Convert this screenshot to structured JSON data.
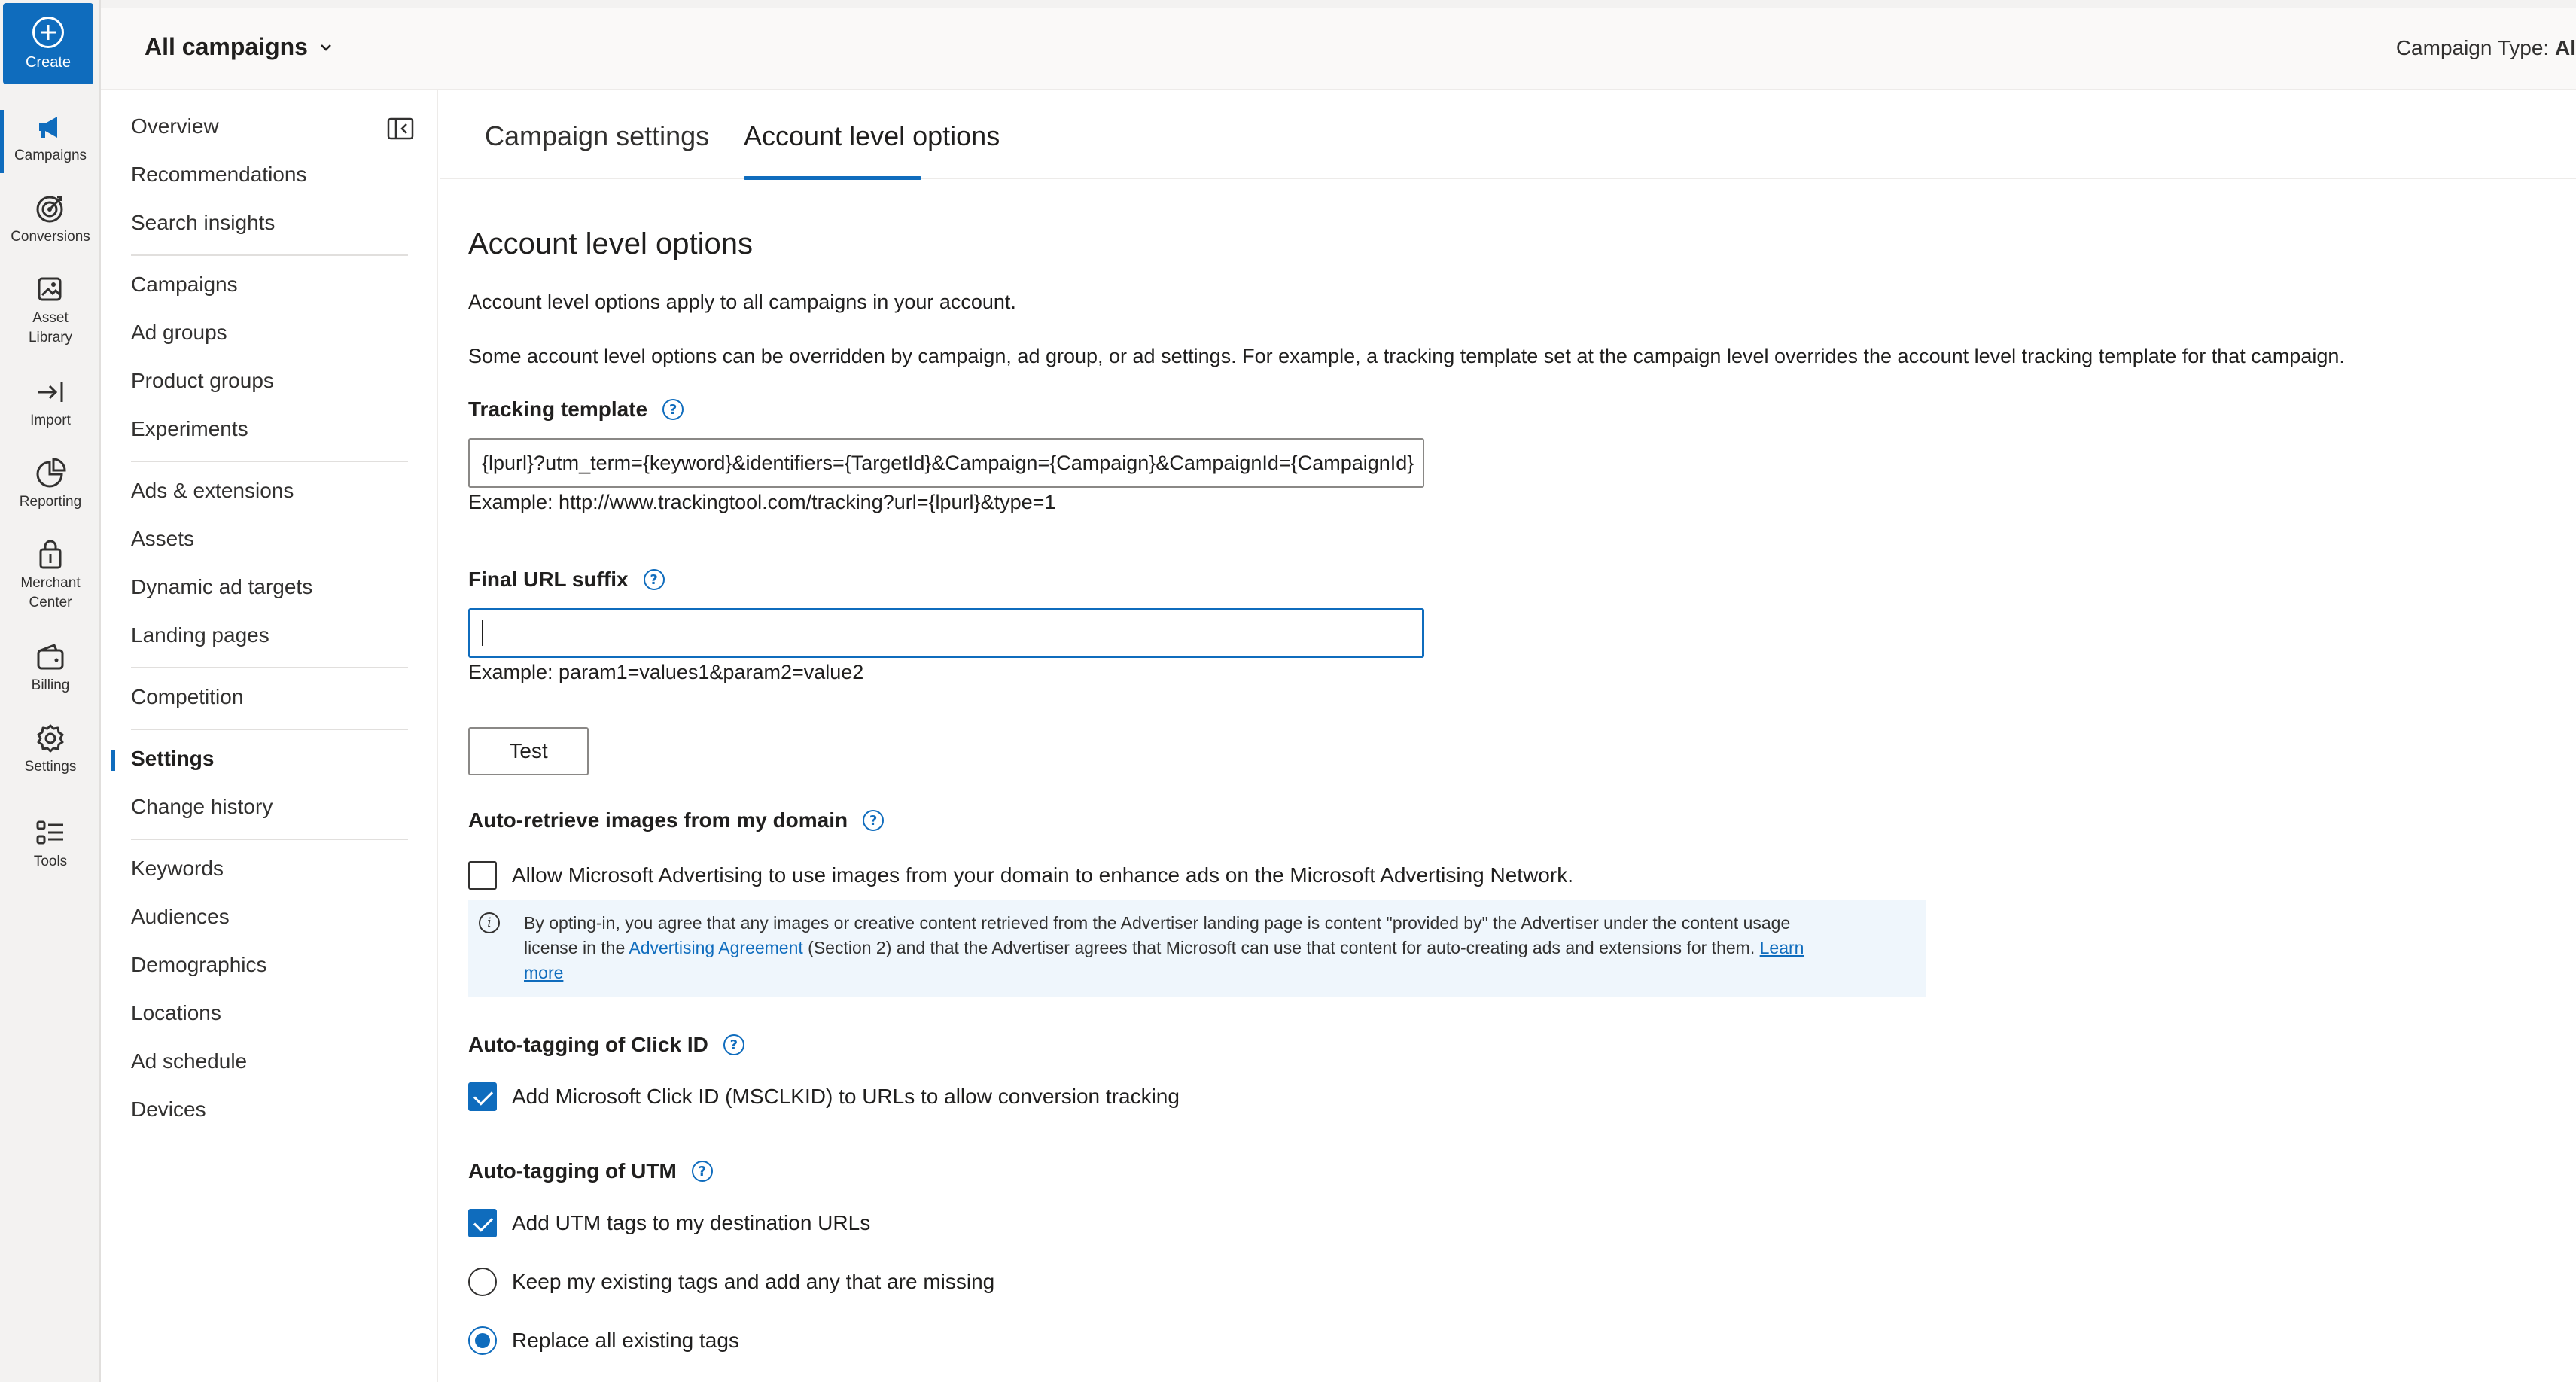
{
  "rail": {
    "create_label": "Create",
    "items": [
      {
        "label": "Campaigns",
        "icon": "megaphone-icon"
      },
      {
        "label": "Conversions",
        "icon": "target-icon"
      },
      {
        "label": "Asset",
        "label2": "Library",
        "icon": "asset-library-icon"
      },
      {
        "label": "Import",
        "icon": "import-icon"
      },
      {
        "label": "Reporting",
        "icon": "reporting-icon"
      },
      {
        "label": "Merchant",
        "label2": "Center",
        "icon": "shopping-bag-icon"
      },
      {
        "label": "Billing",
        "icon": "wallet-icon"
      },
      {
        "label": "Settings",
        "icon": "gear-icon"
      },
      {
        "label": "Tools",
        "icon": "tools-icon"
      }
    ]
  },
  "header": {
    "campaign_select": "All campaigns",
    "campaign_type_label": "Campaign Type:",
    "campaign_type_value": "Al"
  },
  "subnav": {
    "items": [
      "Overview",
      "Recommendations",
      "Search insights",
      "Campaigns",
      "Ad groups",
      "Product groups",
      "Experiments",
      "Ads & extensions",
      "Assets",
      "Dynamic ad targets",
      "Landing pages",
      "Competition",
      "Settings",
      "Change history",
      "Keywords",
      "Audiences",
      "Demographics",
      "Locations",
      "Ad schedule",
      "Devices"
    ],
    "active": "Settings"
  },
  "tabs": {
    "campaign_settings": "Campaign settings",
    "account_level_options": "Account level options"
  },
  "content": {
    "heading": "Account level options",
    "intro": "Account level options apply to all campaigns in your account.",
    "override_note": "Some account level options can be overridden by campaign, ad group, or ad settings. For example, a tracking template set at the campaign level overrides the account level tracking template for that campaign.",
    "tracking_template": {
      "label": "Tracking template",
      "value": "{lpurl}?utm_term={keyword}&identifiers={TargetId}&Campaign={Campaign}&CampaignId={CampaignId}",
      "example": "Example: http://www.trackingtool.com/tracking?url={lpurl}&type=1"
    },
    "final_url_suffix": {
      "label": "Final URL suffix",
      "value": "",
      "example": "Example: param1=values1&param2=value2"
    },
    "test_button": "Test",
    "auto_retrieve": {
      "label": "Auto-retrieve images from my domain",
      "checkbox_label": "Allow Microsoft Advertising to use images from your domain to enhance ads on the Microsoft Advertising Network.",
      "checked": false,
      "info_part1": "By opting-in, you agree that any images or creative content retrieved from the Advertiser landing page is content \"provided by\" the Advertiser under the content usage",
      "info_part2": "license in the",
      "info_link": "Advertising Agreement",
      "info_part3": "(Section 2) and that the Advertiser agrees that Microsoft can use that content for auto-creating ads and extensions for them.",
      "learn": "Learn",
      "more": "more"
    },
    "click_id": {
      "label": "Auto-tagging of Click ID",
      "checkbox_label": "Add Microsoft Click ID (MSCLKID) to URLs to allow conversion tracking",
      "checked": true
    },
    "utm": {
      "label": "Auto-tagging of UTM",
      "checkbox_label": "Add UTM tags to my destination URLs",
      "checked": true,
      "option_keep": "Keep my existing tags and add any that are missing",
      "option_replace": "Replace all existing tags",
      "selected": "replace"
    }
  }
}
